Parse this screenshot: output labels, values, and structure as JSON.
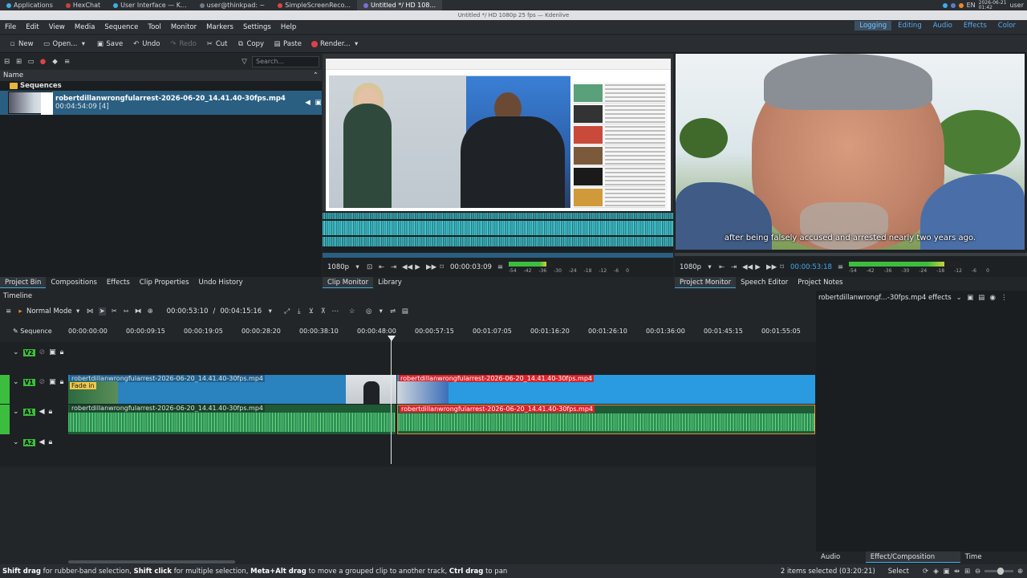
{
  "taskbar": {
    "items": [
      {
        "label": "Applications",
        "active": false
      },
      {
        "label": "HexChat",
        "active": false
      },
      {
        "label": "User Interface — K...",
        "active": false
      },
      {
        "label": "user@thinkpad: ~",
        "active": false
      },
      {
        "label": "SimpleScreenReco...",
        "active": false
      },
      {
        "label": "Untitled */ HD 108...",
        "active": true
      }
    ],
    "tray_lang": "EN",
    "clock_date": "2026-06-21",
    "clock_time": "01:42",
    "user": "user"
  },
  "window_title": "Untitled */ HD 1080p 25 fps — Kdenlive",
  "menu": [
    "File",
    "Edit",
    "View",
    "Media",
    "Sequence",
    "Tool",
    "Monitor",
    "Markers",
    "Settings",
    "Help"
  ],
  "workspaces": [
    {
      "label": "Logging",
      "active": true
    },
    {
      "label": "Editing",
      "active": false
    },
    {
      "label": "Audio",
      "active": false
    },
    {
      "label": "Effects",
      "active": false
    },
    {
      "label": "Color",
      "active": false
    }
  ],
  "toolbar": {
    "new": "New",
    "open": "Open...",
    "save": "Save",
    "undo": "Undo",
    "redo": "Redo",
    "cut": "Cut",
    "copy": "Copy",
    "paste": "Paste",
    "render": "Render..."
  },
  "bin": {
    "search_placeholder": "Search...",
    "header": "Name",
    "folder": "Sequences",
    "clip_name": "robertdillanwrongfularrest-2026-06-20_14.41.40-30fps.mp4",
    "clip_meta": "00:04:54:09 [4]"
  },
  "bin_tabs": [
    "Project Bin",
    "Compositions",
    "Effects",
    "Clip Properties",
    "Undo History"
  ],
  "clip_monitor": {
    "resolution": "1080p",
    "timecode": "00:00:03:09",
    "scale_labels": [
      "-54",
      "-42",
      "-36",
      "-30",
      "-24",
      "-18",
      "-12",
      "-6",
      "0"
    ]
  },
  "clip_monitor_tabs": [
    "Clip Monitor",
    "Library"
  ],
  "project_monitor": {
    "resolution": "1080p",
    "timecode": "00:00:53:18",
    "subtitle": "after being falsely accused and arrested nearly two years ago.",
    "scale_labels": [
      "-54",
      "-42",
      "-36",
      "-30",
      "-24",
      "-18",
      "-12",
      "-6",
      "0"
    ]
  },
  "project_monitor_tabs": [
    "Project Monitor",
    "Speech Editor",
    "Project Notes"
  ],
  "timeline": {
    "title": "Timeline",
    "mode": "Normal Mode",
    "position": "00:00:53:10",
    "duration": "00:04:15:16",
    "sequence_label": "Sequence",
    "ruler": [
      "00:00:00:00",
      "00:00:09:15",
      "00:00:19:05",
      "00:00:28:20",
      "00:00:38:10",
      "00:00:48:00",
      "00:00:57:15",
      "00:01:07:05",
      "00:01:16:20",
      "00:01:26:10",
      "00:01:36:00",
      "00:01:45:15",
      "00:01:55:05"
    ],
    "tracks": [
      "V2",
      "V1",
      "A1",
      "A2"
    ],
    "clip_name": "robertdillanwrongfularrest-2026-06-20_14.41.40-30fps.mp4",
    "fade_label": "Fade in"
  },
  "effects_panel": {
    "title": "robertdillanwrongf...-30fps.mp4 effects"
  },
  "bottom_tabs": [
    "Audio Mixer",
    "Effect/Composition Stack",
    "Time Remapping"
  ],
  "status": {
    "hint_parts": [
      {
        "b": "Shift drag",
        "t": " for rubber-band selection, "
      },
      {
        "b": "Shift click",
        "t": " for multiple selection, "
      },
      {
        "b": "Meta+Alt drag",
        "t": " to move a grouped clip to another track, "
      },
      {
        "b": "Ctrl drag",
        "t": " to pan"
      }
    ],
    "selection": "2 items selected (03:20:21)",
    "tool": "Select"
  },
  "colors": {
    "accent": "#3daee9",
    "track_green": "#3dbd3d",
    "clip_blue": "#2a95d6",
    "clip_red_label": "#d9232c"
  }
}
